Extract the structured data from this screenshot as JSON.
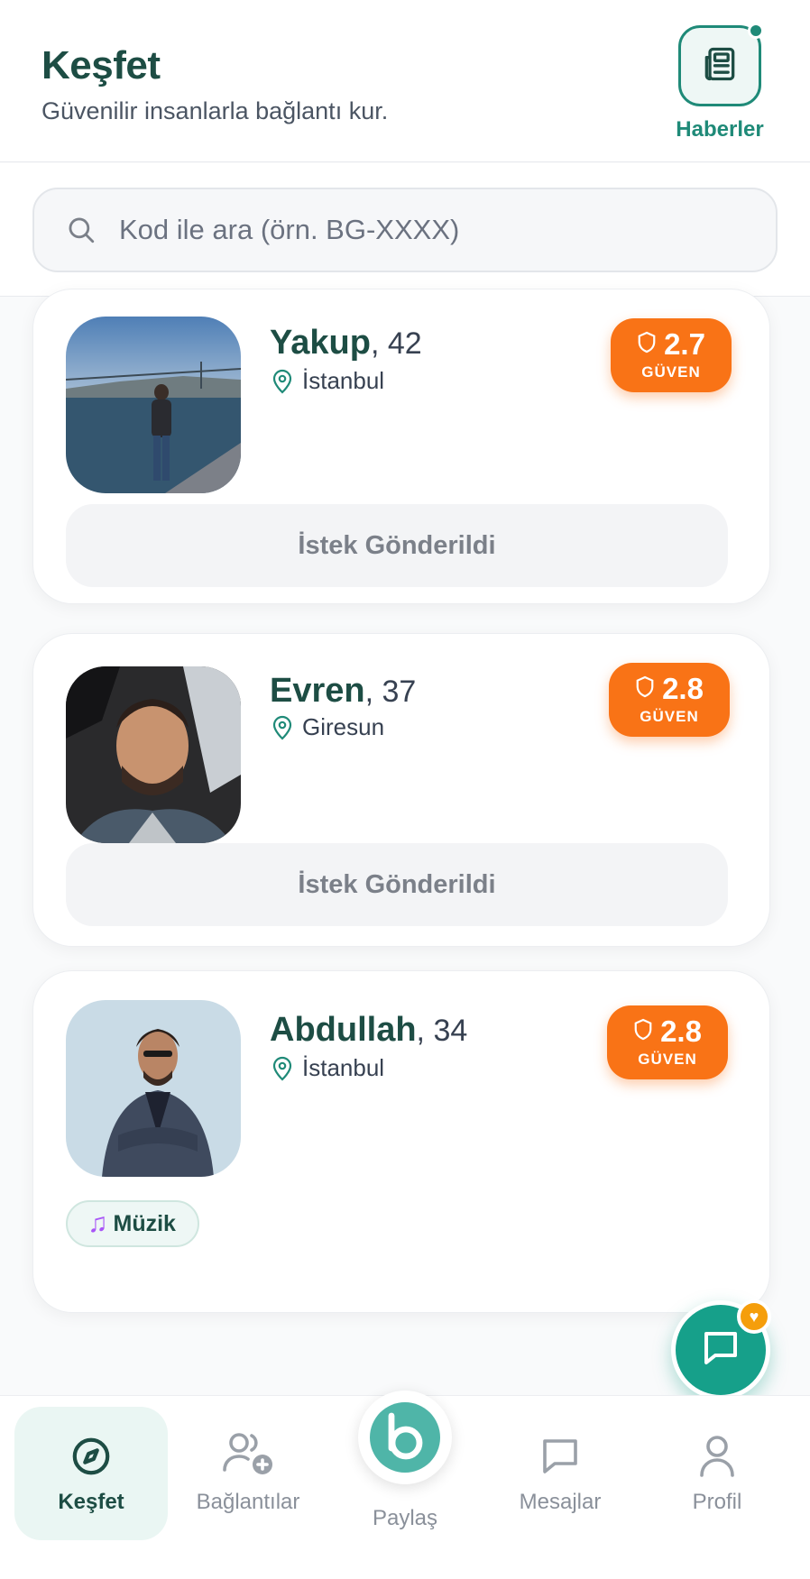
{
  "header": {
    "title": "Keşfet",
    "subtitle": "Güvenilir insanlarla bağlantı kur.",
    "news_label": "Haberler",
    "news_icon": "newspaper-icon"
  },
  "search": {
    "placeholder": "Kod ile ara (örn. BG-XXXX)",
    "icon": "search-icon"
  },
  "colors": {
    "brand": "#1d4d44",
    "accent": "#1f8a78",
    "trust_badge": "#f97316"
  },
  "profiles": [
    {
      "name": "Yakup",
      "age": ", 42",
      "location": "İstanbul",
      "trust_score": "2.7",
      "trust_label": "GÜVEN",
      "action_label": "İstek Gönderildi"
    },
    {
      "name": "Evren",
      "age": ", 37",
      "location": "Giresun",
      "trust_score": "2.8",
      "trust_label": "GÜVEN",
      "action_label": "İstek Gönderildi"
    },
    {
      "name": "Abdullah",
      "age": ", 34",
      "location": "İstanbul",
      "trust_score": "2.8",
      "trust_label": "GÜVEN",
      "tag": "Müzik"
    }
  ],
  "bottom_nav": {
    "items": [
      {
        "label": "Keşfet",
        "icon": "compass-icon",
        "active": true
      },
      {
        "label": "Bağlantılar",
        "icon": "users-add-icon"
      },
      {
        "label": "Paylaş",
        "icon": "share-logo-icon"
      },
      {
        "label": "Mesajlar",
        "icon": "message-icon"
      },
      {
        "label": "Profil",
        "icon": "user-icon"
      }
    ]
  }
}
